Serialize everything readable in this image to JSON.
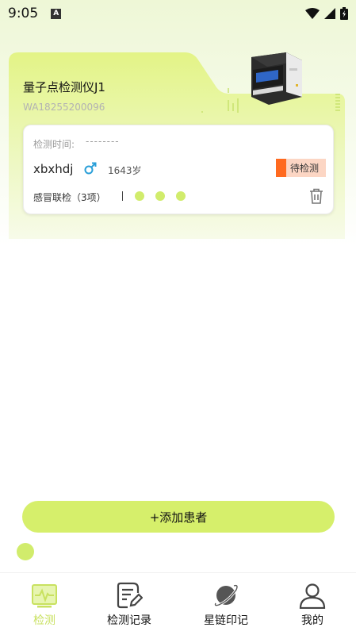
{
  "status_bar": {
    "time": "9:05",
    "notification_letter": "A"
  },
  "device": {
    "name": "量子点检测仪J1",
    "serial": "WA18255200096"
  },
  "patient": {
    "time_label": "检测时间:",
    "time_value": "--------",
    "name": "xbxhdj",
    "gender": "male",
    "age": "1643岁",
    "status": "待检测",
    "test_name": "感冒联检（3项）",
    "test_item_count": 3
  },
  "actions": {
    "add_patient": "+添加患者"
  },
  "bottom_nav": {
    "items": [
      {
        "label": "检测",
        "icon": "monitor-icon",
        "active": true
      },
      {
        "label": "检测记录",
        "icon": "document-edit-icon",
        "active": false
      },
      {
        "label": "星链印记",
        "icon": "planet-icon",
        "active": false
      },
      {
        "label": "我的",
        "icon": "user-icon",
        "active": false
      }
    ]
  },
  "colors": {
    "accent": "#d6ef6b",
    "accent_active_text": "#c8e15f",
    "status_badge_bg": "#fcd6c4",
    "status_badge_bar": "#ff6a1f",
    "gender_male": "#2a9fd8"
  }
}
